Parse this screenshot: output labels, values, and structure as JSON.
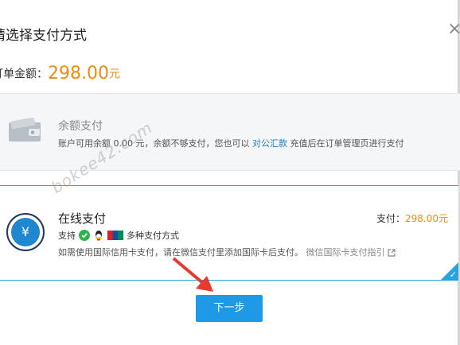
{
  "dialog": {
    "title": "请选择支付方式",
    "close": "×"
  },
  "order": {
    "label": "订单金额：",
    "value": "298.00",
    "unit": "元"
  },
  "balance": {
    "title": "余额支付",
    "desc_prefix": "账户可用余额 0.00 元，余额不够支付，您也可以",
    "link": "对公汇款",
    "desc_suffix": "充值后在订单管理页进行支付"
  },
  "online": {
    "title": "在线支付",
    "amount_label": "支付：",
    "amount_value": "298.00元",
    "support_label": "支持",
    "methods_label": "多种支付方式",
    "note": "如需使用国际信用卡支付，请在微信支付里添加国际卡后支付。",
    "note_link": "微信国际卡支付指引",
    "icons": [
      "wechat-icon",
      "qq-icon",
      "unionpay-icon",
      "external-link-icon",
      "yen-icon",
      "wallet-icon",
      "checkmark-icon"
    ]
  },
  "next_button": "下一步",
  "watermark": "bokee42.com",
  "colors": {
    "accent": "#1f98e5",
    "price": "#f08a0c",
    "border_selected": "#29a3e0",
    "arrow": "#e8382f"
  }
}
